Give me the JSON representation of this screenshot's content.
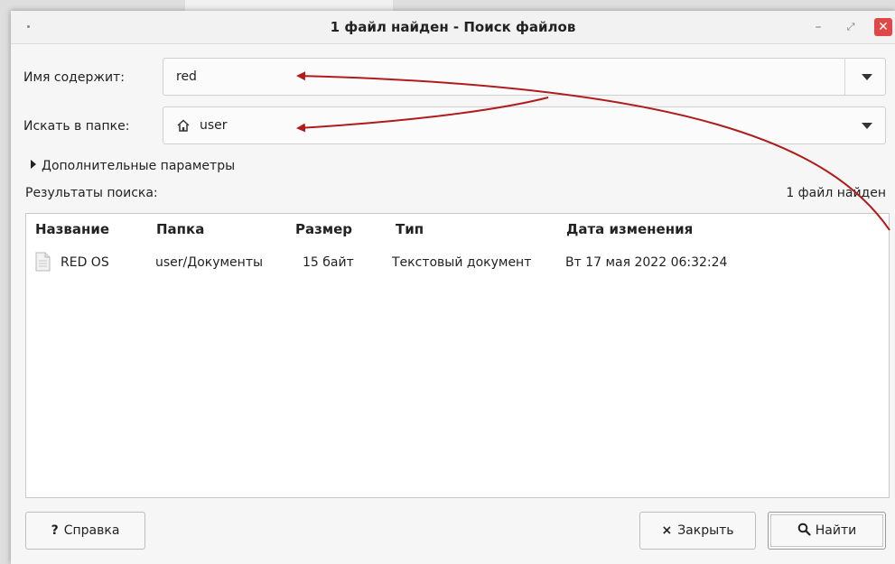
{
  "window": {
    "title": "1 файл найден - Поиск файлов",
    "min_symbol": "–",
    "max_symbol": "⤢",
    "close_symbol": "✕"
  },
  "form": {
    "name_label": "Имя содержит:",
    "name_value": "red",
    "folder_label": "Искать в папке:",
    "folder_value": "user",
    "folder_icon": "home-icon",
    "extra_options": "Дополнительные параметры"
  },
  "results": {
    "label": "Результаты поиска:",
    "count_text": "1 файл найден",
    "columns": [
      "Название",
      "Папка",
      "Размер",
      "Тип",
      "Дата изменения"
    ],
    "rows": [
      {
        "name": "RED OS",
        "folder": "user/Документы",
        "size": "15 байт",
        "type": "Текстовый документ",
        "modified": "Вт 17 мая 2022 06:32:24",
        "icon": "text-file-icon"
      }
    ]
  },
  "buttons": {
    "help_icon": "?",
    "help": "Справка",
    "close_icon": "×",
    "close": "Закрыть",
    "find_icon": "search-icon",
    "find": "Найти"
  },
  "colors": {
    "annotation_arrow": "#b01c1c",
    "close_button": "#e04848"
  }
}
